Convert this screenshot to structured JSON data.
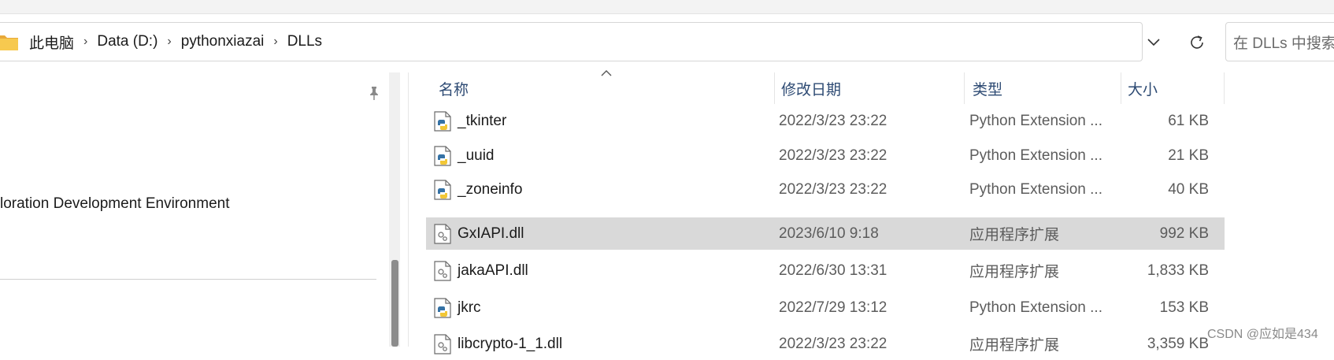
{
  "breadcrumb": {
    "items": [
      "此电脑",
      "Data (D:)",
      "pythonxiazai",
      "DLLs"
    ],
    "separator": "›"
  },
  "search": {
    "placeholder": "在 DLLs 中搜索"
  },
  "nav": {
    "visible_item": "loration Development Environment"
  },
  "columns": {
    "name": "名称",
    "date": "修改日期",
    "type": "类型",
    "size": "大小"
  },
  "files": [
    {
      "name": "_tkinter",
      "date": "2022/3/23 23:22",
      "type": "Python Extension ...",
      "size": "61 KB",
      "icon": "python-file-icon"
    },
    {
      "name": "_uuid",
      "date": "2022/3/23 23:22",
      "type": "Python Extension ...",
      "size": "21 KB",
      "icon": "python-file-icon"
    },
    {
      "name": "_zoneinfo",
      "date": "2022/3/23 23:22",
      "type": "Python Extension ...",
      "size": "40 KB",
      "icon": "python-file-icon"
    },
    {
      "name": "GxIAPI.dll",
      "date": "2023/6/10 9:18",
      "type": "应用程序扩展",
      "size": "992 KB",
      "icon": "dll-file-icon",
      "selected": true
    },
    {
      "name": "jakaAPI.dll",
      "date": "2022/6/30 13:31",
      "type": "应用程序扩展",
      "size": "1,833 KB",
      "icon": "dll-file-icon"
    },
    {
      "name": "jkrc",
      "date": "2022/7/29 13:12",
      "type": "Python Extension ...",
      "size": "153 KB",
      "icon": "python-file-icon"
    },
    {
      "name": "libcrypto-1_1.dll",
      "date": "2022/3/23 23:22",
      "type": "应用程序扩展",
      "size": "3,359 KB",
      "icon": "dll-file-icon"
    }
  ],
  "watermark": "CSDN @应如是434",
  "colors": {
    "selected_row": "#d9d9d9",
    "header_text": "#2d4a73",
    "folder": "#f2c14e"
  }
}
